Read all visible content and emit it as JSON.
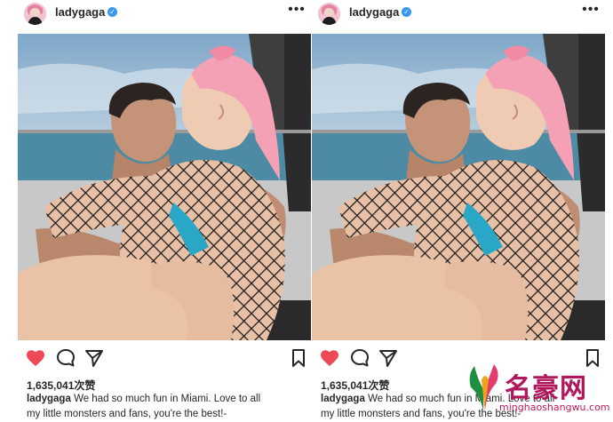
{
  "posts": [
    {
      "username": "ladygaga",
      "likes": "1,635,041次赞",
      "caption_user": "ladygaga",
      "caption_line1": "We had so much fun in Miami. Love to all",
      "caption_line2": "my little monsters and fans, you're the best!-"
    },
    {
      "username": "ladygaga",
      "likes": "1,635,041次赞",
      "caption_user": "ladygaga",
      "caption_line1": "We had so much fun in Miami. Love to all",
      "caption_line2": "my little monsters and fans, you're the best!-"
    }
  ],
  "icons": {
    "avatar": "avatar-icon",
    "verified": "verified-badge-icon",
    "more": "more-options-icon",
    "like": "heart-icon",
    "comment": "comment-icon",
    "share": "send-icon",
    "save": "bookmark-icon"
  },
  "watermark": {
    "brand": "名豪网",
    "url": "minghaoshangwu.com"
  },
  "colors": {
    "like_red": "#ed4956",
    "verified_blue": "#3897f0",
    "watermark_magenta": "#b0175c"
  }
}
